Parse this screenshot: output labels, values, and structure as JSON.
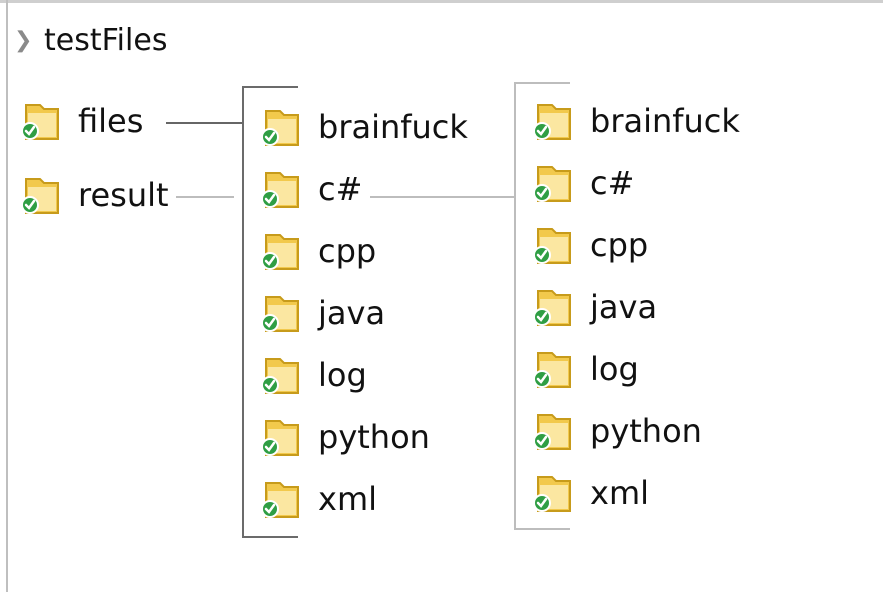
{
  "root": {
    "chevron": "chevron-right-icon",
    "label": "testFiles"
  },
  "column1": [
    {
      "label": "files"
    },
    {
      "label": "result"
    }
  ],
  "column2": [
    {
      "label": "brainfuck"
    },
    {
      "label": "c#"
    },
    {
      "label": "cpp"
    },
    {
      "label": "java"
    },
    {
      "label": "log"
    },
    {
      "label": "python"
    },
    {
      "label": "xml"
    }
  ],
  "column3": [
    {
      "label": "brainfuck"
    },
    {
      "label": "c#"
    },
    {
      "label": "cpp"
    },
    {
      "label": "java"
    },
    {
      "label": "log"
    },
    {
      "label": "python"
    },
    {
      "label": "xml"
    }
  ],
  "icons": {
    "folder": "folder-synced-icon",
    "folder_color": "#f2c94c",
    "check_color": "#2f9e44"
  }
}
